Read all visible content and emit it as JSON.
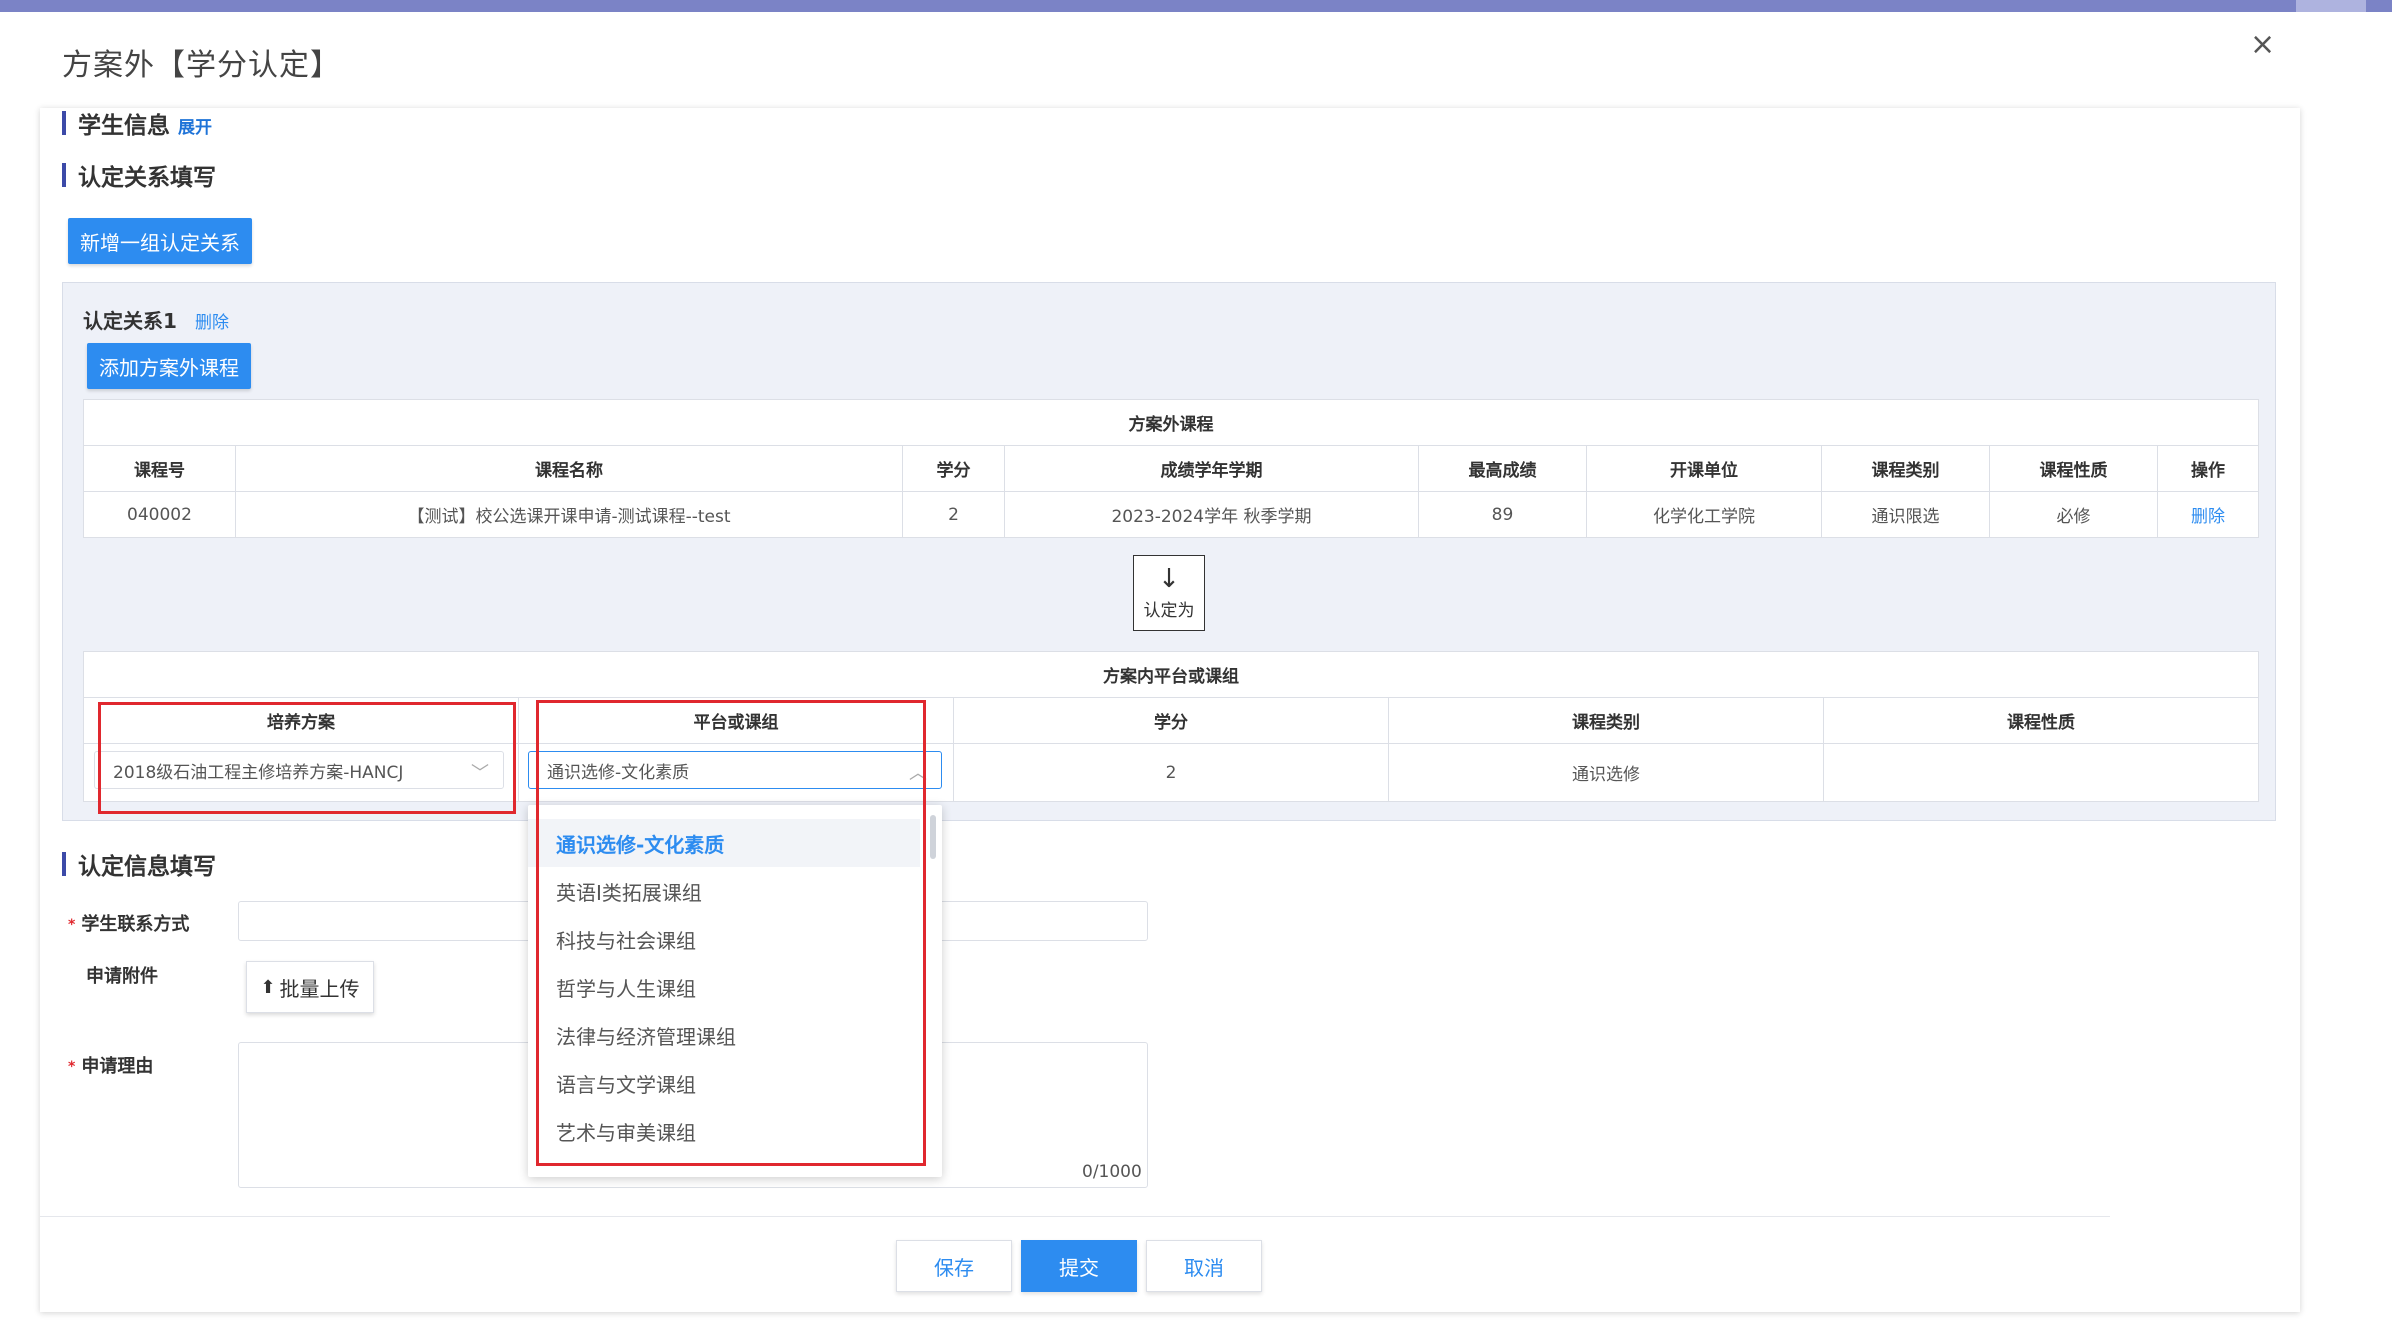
{
  "dialog": {
    "title": "方案外【学分认定】",
    "close_glyph": "×"
  },
  "sections": {
    "student_info": "学生信息",
    "expand_label": "展开",
    "relation_fill": "认定关系填写",
    "info_fill": "认定信息填写"
  },
  "buttons": {
    "add_group": "新增一组认定关系",
    "add_course": "添加方案外课程",
    "upload": "批量上传",
    "save": "保存",
    "submit": "提交",
    "cancel": "取消"
  },
  "group": {
    "title": "认定关系1",
    "delete_label": "删除"
  },
  "outside_table": {
    "caption": "方案外课程",
    "headers": [
      "课程号",
      "课程名称",
      "学分",
      "成绩学年学期",
      "最高成绩",
      "开课单位",
      "课程类别",
      "课程性质",
      "操作"
    ],
    "rows": [
      [
        "040002",
        "【测试】校公选课开课申请-测试课程--test",
        "2",
        "2023-2024学年 秋季学期",
        "89",
        "化学化工学院",
        "通识限选",
        "必修",
        "删除"
      ]
    ]
  },
  "convert": {
    "arrow": "↓",
    "label": "认定为"
  },
  "inside_table": {
    "caption": "方案内平台或课组",
    "headers": [
      "培养方案",
      "平台或课组",
      "学分",
      "课程类别",
      "课程性质"
    ],
    "plan_select": "2018级石油工程主修培养方案-HANCJ",
    "group_select": "通识选修-文化素质",
    "credit": "2",
    "category": "通识选修",
    "nature": ""
  },
  "dropdown": {
    "options": [
      "通识选修-文化素质",
      "英语Ⅰ类拓展课组",
      "科技与社会课组",
      "哲学与人生课组",
      "法律与经济管理课组",
      "语言与文学课组",
      "艺术与审美课组"
    ]
  },
  "form": {
    "contact_label": "学生联系方式",
    "attachment_label": "申请附件",
    "reason_label": "申请理由",
    "required_mark": "*",
    "counter": "0/1000"
  },
  "colors": {
    "primary": "#2d8cf0",
    "accent_bar": "#3c4aa8",
    "highlight": "#e0282e"
  }
}
